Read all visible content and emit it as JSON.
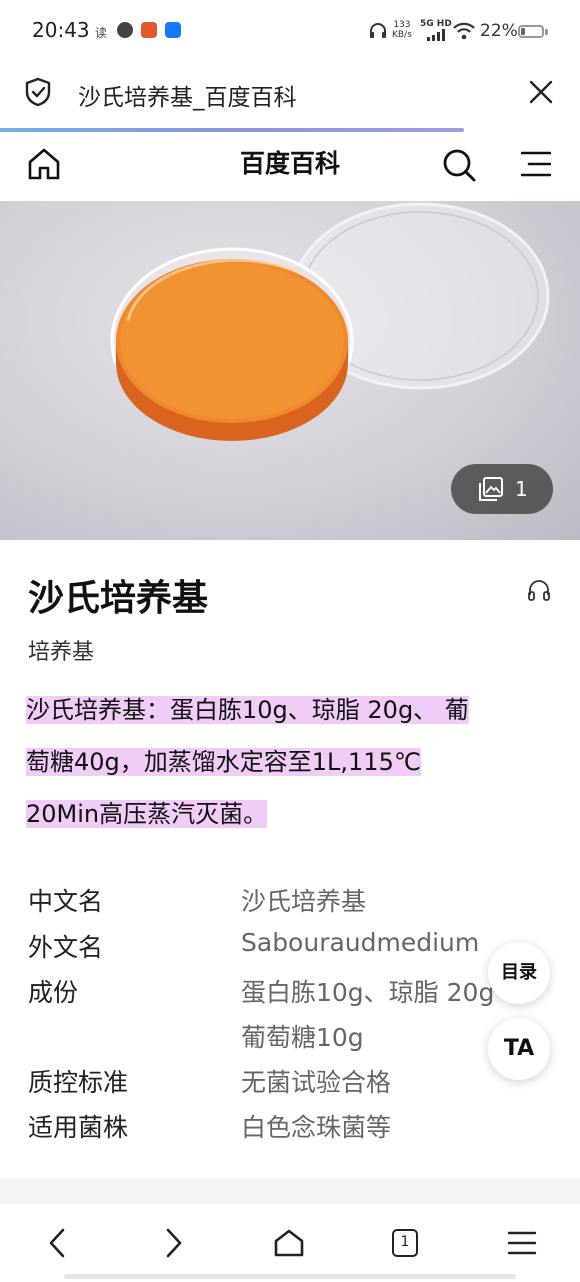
{
  "status_bar": {
    "time": "20:43",
    "read_label": "读",
    "net_speed_value": "133",
    "net_speed_unit": "KB/s",
    "network_label": "5G HD",
    "battery": "22%",
    "battery_level": 0.22,
    "icons": [
      "headphones-icon",
      "signal-icon",
      "wifi-icon",
      "battery-icon"
    ]
  },
  "page_header": {
    "title": "沙氏培养基_百度百科",
    "load_progress": 0.8
  },
  "site_nav": {
    "brand": "百度百科",
    "icons": [
      "home-icon",
      "search-icon",
      "menu-icon"
    ]
  },
  "hero": {
    "gallery_count": "1"
  },
  "article": {
    "title": "沙氏培养基",
    "subtitle": "培养基",
    "summary_lines": [
      "沙氏培养基：蛋白胨10g、琼脂 20g、 葡",
      "萄糖40g，加蒸馏水定容至1L,115℃",
      "20Min高压蒸汽灭菌。"
    ],
    "info_rows": [
      {
        "label": "中文名",
        "value": "沙氏培养基"
      },
      {
        "label": "外文名",
        "value": "Sabouraudmedium"
      },
      {
        "label": "成份",
        "value": "蛋白胨10g、琼脂 20g"
      },
      {
        "label": "",
        "value": "葡萄糖10g"
      },
      {
        "label": "质控标准",
        "value": "无菌试验合格"
      },
      {
        "label": "适用菌株",
        "value": "白色念珠菌等"
      }
    ]
  },
  "floating": {
    "toc_label": "目录",
    "font_label": "TA"
  },
  "bottom_bar": {
    "tab_count": "1",
    "icons": [
      "back-icon",
      "forward-icon",
      "home-icon",
      "tabs-icon",
      "menu-icon"
    ]
  },
  "colors": {
    "highlight": "#efcdf6",
    "progress": "#8b93e0"
  }
}
